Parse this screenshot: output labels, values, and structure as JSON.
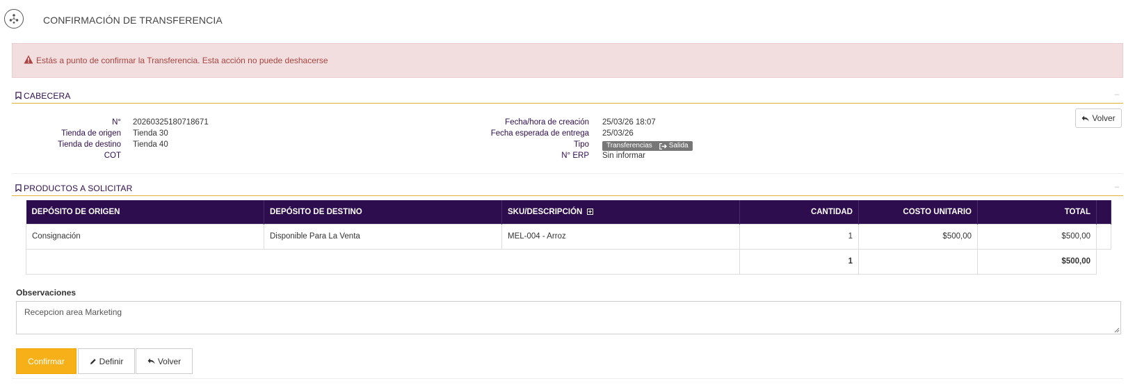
{
  "header": {
    "title": "CONFIRMACIÓN DE TRANSFERENCIA"
  },
  "alert": {
    "text": "Estás a punto de confirmar la Transferencia. Esta acción no puede deshacerse"
  },
  "cabecera": {
    "title": "CABECERA",
    "collapse": "–",
    "left": [
      {
        "label": "N°",
        "value": "20260325180718671"
      },
      {
        "label": "Tienda de origen",
        "value": "Tienda 30"
      },
      {
        "label": "Tienda de destino",
        "value": "Tienda 40"
      },
      {
        "label": "COT",
        "value": ""
      }
    ],
    "right": {
      "creation_label": "Fecha/hora de creación",
      "creation_value": "25/03/26 18:07",
      "delivery_label": "Fecha esperada de entrega",
      "delivery_value": "25/03/26",
      "tipo_label": "Tipo",
      "tipo_tag": "Transferencias",
      "tipo_tag2": "Salida",
      "erp_label": "N° ERP",
      "erp_value": "Sin informar"
    },
    "back_button": "Volver"
  },
  "productos": {
    "title": "PRODUCTOS A SOLICITAR",
    "collapse": "–",
    "columns": [
      "DEPÓSITO DE ORIGEN",
      "DEPÓSITO DE DESTINO",
      "SKU/DESCRIPCIÓN",
      "CANTIDAD",
      "COSTO UNITARIO",
      "TOTAL"
    ],
    "rows": [
      {
        "origen": "Consignación",
        "destino": "Disponible Para La Venta",
        "sku": "MEL-004 - Arroz",
        "cantidad": "1",
        "costo": "$500,00",
        "total": "$500,00"
      }
    ],
    "totals": {
      "cantidad": "1",
      "total": "$500,00"
    }
  },
  "observaciones": {
    "label": "Observaciones",
    "value": "Recepcion area Marketing"
  },
  "actions": {
    "confirm": "Confirmar",
    "define": "Definir",
    "back": "Volver"
  },
  "colors": {
    "primary": "#2e0d4e",
    "accent": "#f7b018",
    "alert_bg": "#f2dede",
    "alert_text": "#a94442"
  }
}
